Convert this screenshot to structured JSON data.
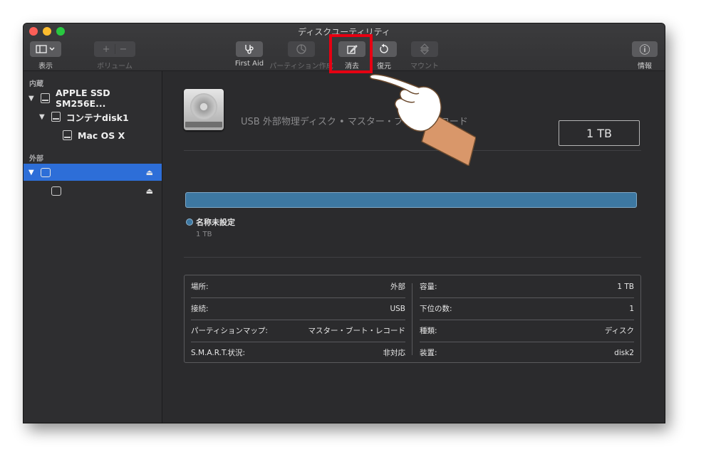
{
  "window": {
    "title": "ディスクユーティリティ"
  },
  "toolbar": {
    "view_label": "表示",
    "volume_label": "ボリューム",
    "volume_add": "+",
    "volume_remove": "−",
    "firstaid_label": "First Aid",
    "partition_label": "パーティション作成",
    "erase_label": "消去",
    "restore_label": "復元",
    "mount_label": "マウント",
    "info_label": "情報",
    "info_glyph": "ⓘ"
  },
  "sidebar": {
    "internal_header": "内蔵",
    "external_header": "外部",
    "internal_items": [
      {
        "label": "APPLE SSD SM256E..."
      },
      {
        "label": "コンテナdisk1"
      },
      {
        "label": "Mac OS X"
      }
    ],
    "external_items": [
      {
        "label": ""
      },
      {
        "label": ""
      }
    ],
    "eject_glyph": "⏏",
    "disclosure_glyph": "▼"
  },
  "disk": {
    "description": "USB 外部物理ディスク • マスター・ブート・レコード",
    "capacity": "1 TB"
  },
  "partition": {
    "name": "名称未設定",
    "size": "1 TB",
    "color": "#3d78a2"
  },
  "info": {
    "left": [
      {
        "key": "場所:",
        "value": "外部"
      },
      {
        "key": "接続:",
        "value": "USB"
      },
      {
        "key": "パーティションマップ:",
        "value": "マスター・ブート・レコード"
      },
      {
        "key": "S.M.A.R.T.状況:",
        "value": "非対応"
      }
    ],
    "right": [
      {
        "key": "容量:",
        "value": "1 TB"
      },
      {
        "key": "下位の数:",
        "value": "1"
      },
      {
        "key": "種類:",
        "value": "ディスク"
      },
      {
        "key": "装置:",
        "value": "disk2"
      }
    ]
  },
  "colors": {
    "highlight": "#e60012",
    "selection": "#2d6ed8"
  }
}
